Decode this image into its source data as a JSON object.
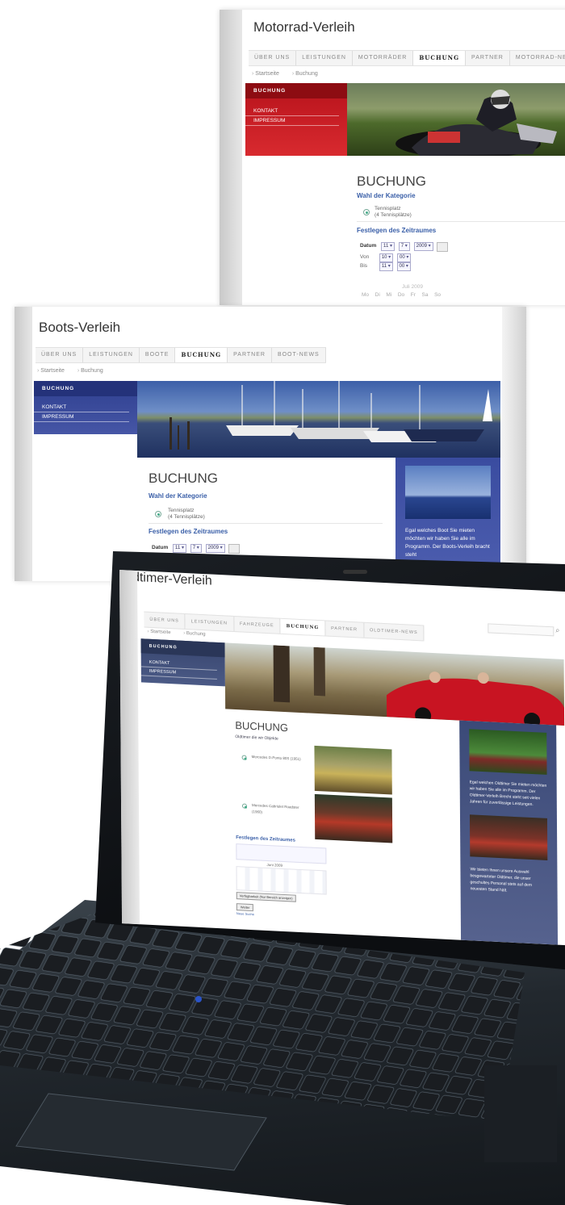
{
  "motorrad": {
    "title": "Motorrad-Verleih",
    "nav": [
      "ÜBER UNS",
      "LEISTUNGEN",
      "MOTORRÄDER",
      "BUCHUNG",
      "PARTNER",
      "MOTORRAD-NEWS"
    ],
    "breadcrumb": [
      "Startseite",
      "Buchung"
    ],
    "sidebar_head": "BUCHUNG",
    "sidebar_items": [
      "KONTAKT",
      "IMPRESSUM"
    ],
    "heading": "BUCHUNG",
    "section1": "Wahl der Kategorie",
    "option_line1": "Tennisplatz",
    "option_line2": "(4 Tennisplätze)",
    "section2": "Festlegen des Zeitraumes",
    "date_label": "Datum",
    "date_day": "11",
    "date_month": "7",
    "date_year": "2009",
    "von_label": "Von",
    "von_h": "10",
    "von_m": "00",
    "bis_label": "Bis",
    "bis_h": "11",
    "bis_m": "00",
    "cal_title": "Juli 2009",
    "cal_days": "Mo  Di  Mi  Do  Fr  Sa  So",
    "accent": "#c0141e"
  },
  "boots": {
    "title": "Boots-Verleih",
    "nav": [
      "ÜBER UNS",
      "LEISTUNGEN",
      "BOOTE",
      "BUCHUNG",
      "PARTNER",
      "BOOT-NEWS"
    ],
    "breadcrumb": [
      "Startseite",
      "Buchung"
    ],
    "sidebar_head": "BUCHUNG",
    "sidebar_items": [
      "KONTAKT",
      "IMPRESSUM"
    ],
    "heading": "BUCHUNG",
    "section1": "Wahl der Kategorie",
    "option_line1": "Tennisplatz",
    "option_line2": "(4 Tennisplätze)",
    "section2": "Festlegen des Zeitraumes",
    "date_label": "Datum",
    "date_day": "11",
    "date_month": "7",
    "date_year": "2009",
    "promo_text": "Egal welches Boot Sie mieten möchten wir haben Sie alle im Programm. Der Boots-Verleih bracht steht",
    "accent": "#2e3f8f"
  },
  "oldtimer": {
    "title": "Oldtimer-Verleih",
    "nav": [
      "ÜBER UNS",
      "LEISTUNGEN",
      "FAHRZEUGE",
      "BUCHUNG",
      "PARTNER",
      "OLDTIMER-NEWS"
    ],
    "breadcrumb": [
      "Startseite",
      "Buchung"
    ],
    "sidebar_head": "BUCHUNG",
    "sidebar_items": [
      "KONTAKT",
      "IMPRESSUM"
    ],
    "heading": "BUCHUNG",
    "subheading": "Oldtimer die wir Objekte",
    "car1": "Mercedes D-Ponto 80S (1951)",
    "car2": "Mercedes Cabriolet Roadster (1960)",
    "section2": "Festlegen des Zeitraumes",
    "cal_title": "Juni 2009",
    "button1": "Verfügbarkeit (Nur Bereich anzeigen)",
    "button2": "Weiter",
    "link": "Neue Suche",
    "promo_text1": "Egal welchen Oldtimer Sie mieten möchten wir haben Sie alle im Programm. Der Oldtimer-Verleih Brecht steht seit vielen Jahren für zuverlässige Leistungen.",
    "promo_text2": "Wir bieten Ihnen unsere Auswahl besgewarteter Oldtimer, die unser geschultes Personal stets auf dem neuesten Stand hält.",
    "accent": "#37456e"
  }
}
